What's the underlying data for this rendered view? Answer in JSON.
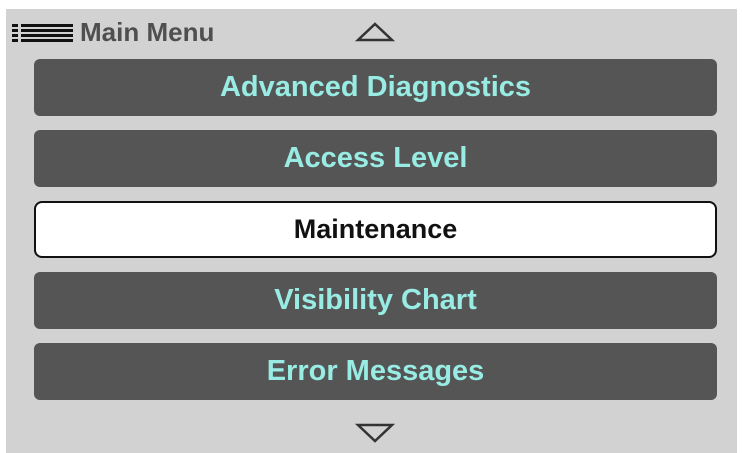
{
  "header": {
    "icon": "menu-list-icon",
    "title": "Main Menu"
  },
  "scroll": {
    "up_icon": "triangle-up-outline-icon",
    "down_icon": "triangle-down-outline-icon"
  },
  "menu": {
    "items": [
      {
        "label": "Advanced Diagnostics",
        "selected": false
      },
      {
        "label": "Access Level",
        "selected": false
      },
      {
        "label": "Maintenance",
        "selected": true
      },
      {
        "label": "Visibility Chart",
        "selected": false
      },
      {
        "label": "Error Messages",
        "selected": false
      }
    ]
  },
  "colors": {
    "panel_background": "#d2d2d2",
    "item_background": "#555555",
    "item_text": "#98ece4",
    "selected_background": "#ffffff",
    "selected_text": "#111111",
    "header_text": "#4f4f4f"
  }
}
